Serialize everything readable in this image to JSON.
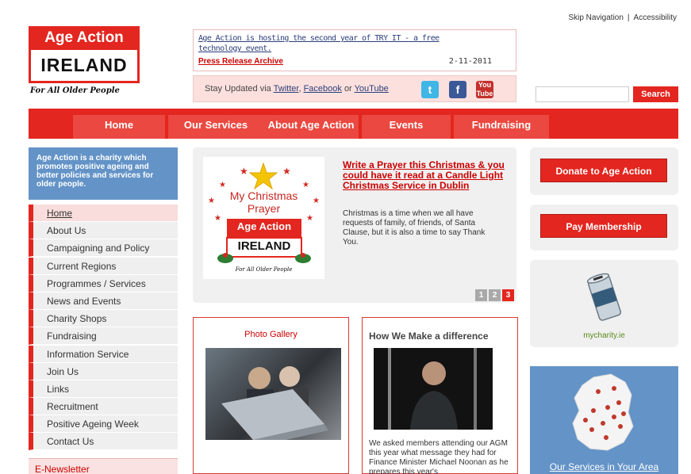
{
  "header": {
    "skip_nav": "Skip Navigation",
    "separator": "|",
    "accessibility": "Accessibility"
  },
  "logo": {
    "top": "Age Action",
    "bottom": "IRELAND",
    "tagline": "For All Older People"
  },
  "news": {
    "headline": "Age Action is hosting the second year of TRY IT - a free technology event.",
    "archive": "Press Release Archive",
    "date": "2-11-2011"
  },
  "social": {
    "prefix": "Stay Updated via",
    "twitter": "Twitter",
    "comma": ",",
    "facebook": "Facebook",
    "or": "or",
    "youtube": "YouTube",
    "twitter_glyph": "t",
    "facebook_glyph": "f",
    "youtube_glyph": "You Tube"
  },
  "search": {
    "placeholder": "",
    "button": "Search"
  },
  "nav": [
    {
      "label": "Home"
    },
    {
      "label": "Our Services"
    },
    {
      "label": "About Age Action"
    },
    {
      "label": "Events"
    },
    {
      "label": "Fundraising"
    }
  ],
  "intro": "Age Action is a charity which promotes positive ageing and better policies and services for older people.",
  "sidebar": {
    "items": [
      {
        "label": "Home"
      },
      {
        "label": "About Us"
      },
      {
        "label": "Campaigning and Policy"
      },
      {
        "label": "Current Regions"
      },
      {
        "label": "Programmes / Services"
      },
      {
        "label": "News and Events"
      },
      {
        "label": "Charity Shops"
      },
      {
        "label": "Fundraising"
      },
      {
        "label": "Information Service"
      },
      {
        "label": "Join Us"
      },
      {
        "label": "Links"
      },
      {
        "label": "Recruitment"
      },
      {
        "label": "Positive Ageing Week"
      },
      {
        "label": "Contact Us"
      }
    ],
    "newsletter": "E-Newsletter"
  },
  "feature": {
    "image_line1": "My Christmas",
    "image_line2": "Prayer",
    "image_logo_top": "Age Action",
    "image_logo_bottom": "IRELAND",
    "image_tagline": "For All Older People",
    "title": "Write a Prayer this Christmas & you could have it read at a Candle Light Christmas Service in Dublin",
    "body": "Christmas is a time when we all have requests of family, of friends, of Santa Clause, but it is also a time to say Thank You.",
    "pages": [
      "1",
      "2",
      "3"
    ]
  },
  "gallery": {
    "title": "Photo Gallery"
  },
  "difference": {
    "title": "How We Make a difference",
    "body": "We asked members attending our AGM this year what message they had for Finance Minister Michael Noonan as he prepares this year's"
  },
  "right": {
    "donate": "Donate to Age Action",
    "membership": "Pay Membership",
    "mycharity": "mycharity.ie",
    "services": "Our Services in Your Area"
  },
  "colors": {
    "brand_red": "#e3261f",
    "intro_blue": "#6393c7"
  }
}
